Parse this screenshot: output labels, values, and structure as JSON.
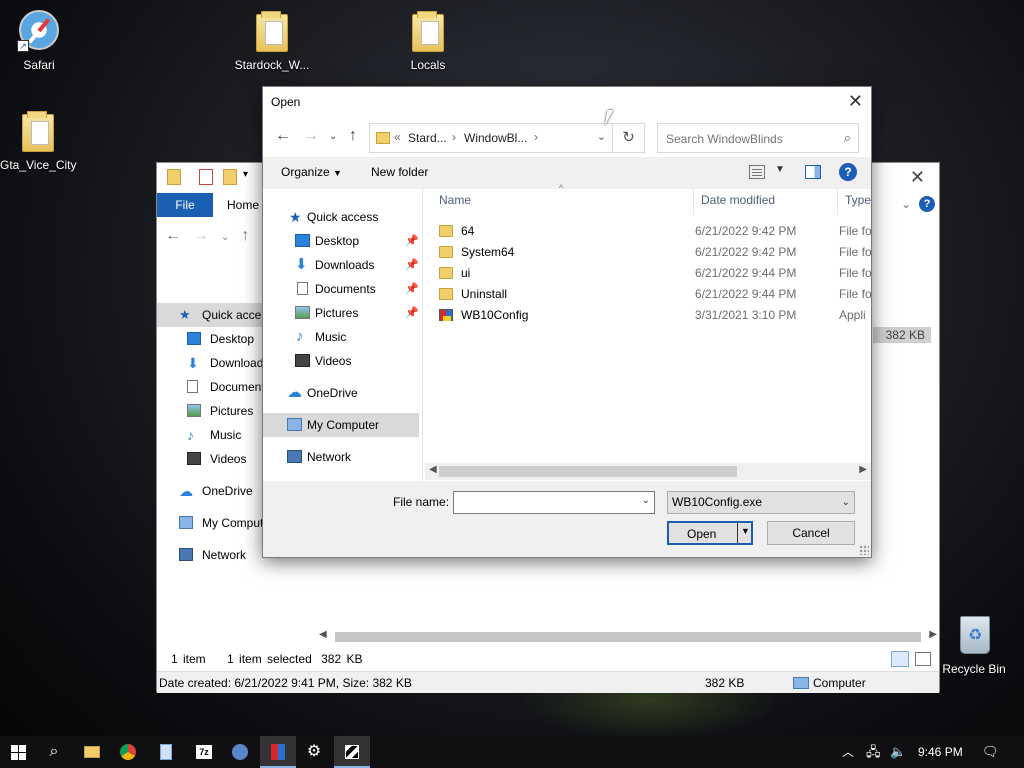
{
  "desktop": {
    "icons": [
      {
        "label": "Safari"
      },
      {
        "label": "Stardock_W..."
      },
      {
        "label": "Locals"
      },
      {
        "label": "Gta_Vice_City"
      },
      {
        "label": "Recycle Bin"
      }
    ]
  },
  "explorer": {
    "tab_file": "File",
    "tab_home": "Home",
    "sidebar": [
      {
        "label": "Quick access"
      },
      {
        "label": "Desktop"
      },
      {
        "label": "Downloads"
      },
      {
        "label": "Documents"
      },
      {
        "label": "Pictures"
      },
      {
        "label": "Music"
      },
      {
        "label": "Videos"
      },
      {
        "label": "OneDrive"
      },
      {
        "label": "My Computer"
      },
      {
        "label": "Network"
      }
    ],
    "right_size": "382 KB",
    "status_count": "1 item",
    "status_selected": "1 item selected",
    "status_size": "382 KB",
    "details": "Date created: 6/21/2022 9:41 PM, Size: 382 KB",
    "details_size": "382 KB",
    "details_location": "Computer"
  },
  "dialog": {
    "title": "Open",
    "address": {
      "prefix": "«",
      "crumbs": [
        "Stard...",
        "WindowBl..."
      ]
    },
    "search_placeholder": "Search WindowBlinds",
    "toolbar": {
      "organize": "Organize",
      "new_folder": "New folder"
    },
    "navpane": [
      {
        "label": "Quick access",
        "pinned": false
      },
      {
        "label": "Desktop",
        "pinned": true
      },
      {
        "label": "Downloads",
        "pinned": true
      },
      {
        "label": "Documents",
        "pinned": true
      },
      {
        "label": "Pictures",
        "pinned": true
      },
      {
        "label": "Music",
        "pinned": false
      },
      {
        "label": "Videos",
        "pinned": false
      },
      {
        "label": "OneDrive",
        "pinned": false
      },
      {
        "label": "My Computer",
        "pinned": false
      },
      {
        "label": "Network",
        "pinned": false
      }
    ],
    "columns": [
      "Name",
      "Date modified",
      "Type"
    ],
    "files": [
      {
        "name": "64",
        "date": "6/21/2022 9:42 PM",
        "type": "File fo",
        "icon": "folder-icon"
      },
      {
        "name": "System64",
        "date": "6/21/2022 9:42 PM",
        "type": "File fo",
        "icon": "folder-icon"
      },
      {
        "name": "ui",
        "date": "6/21/2022 9:44 PM",
        "type": "File fo",
        "icon": "folder-icon"
      },
      {
        "name": "Uninstall",
        "date": "6/21/2022 9:44 PM",
        "type": "File fo",
        "icon": "folder-icon"
      },
      {
        "name": "WB10Config",
        "date": "3/31/2021 3:10 PM",
        "type": "Appli",
        "icon": "application-icon"
      }
    ],
    "file_name_label": "File name:",
    "file_name_value": "",
    "file_type": "WB10Config.exe",
    "open_label": "Open",
    "cancel_label": "Cancel"
  },
  "taskbar": {
    "clock": "9:46 PM"
  }
}
